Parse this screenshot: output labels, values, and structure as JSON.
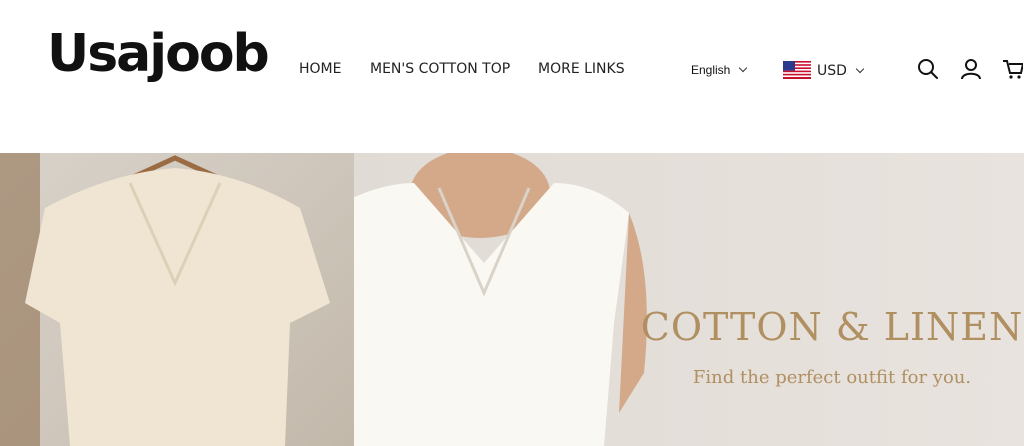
{
  "brand": {
    "logo_text": "Usajoob"
  },
  "nav": {
    "items": [
      {
        "label": "HOME"
      },
      {
        "label": "MEN'S COTTON TOP"
      },
      {
        "label": "MORE LINKS"
      }
    ]
  },
  "language": {
    "selected": "English"
  },
  "currency": {
    "selected": "USD",
    "flag_icon": "us-flag-icon"
  },
  "icons": {
    "search": "search-icon",
    "account": "user-icon",
    "cart": "cart-icon"
  },
  "hero": {
    "title": "COTTON & LINEN",
    "subtitle": "Find the perfect outfit for you.",
    "accent_color": "#b08f61"
  }
}
